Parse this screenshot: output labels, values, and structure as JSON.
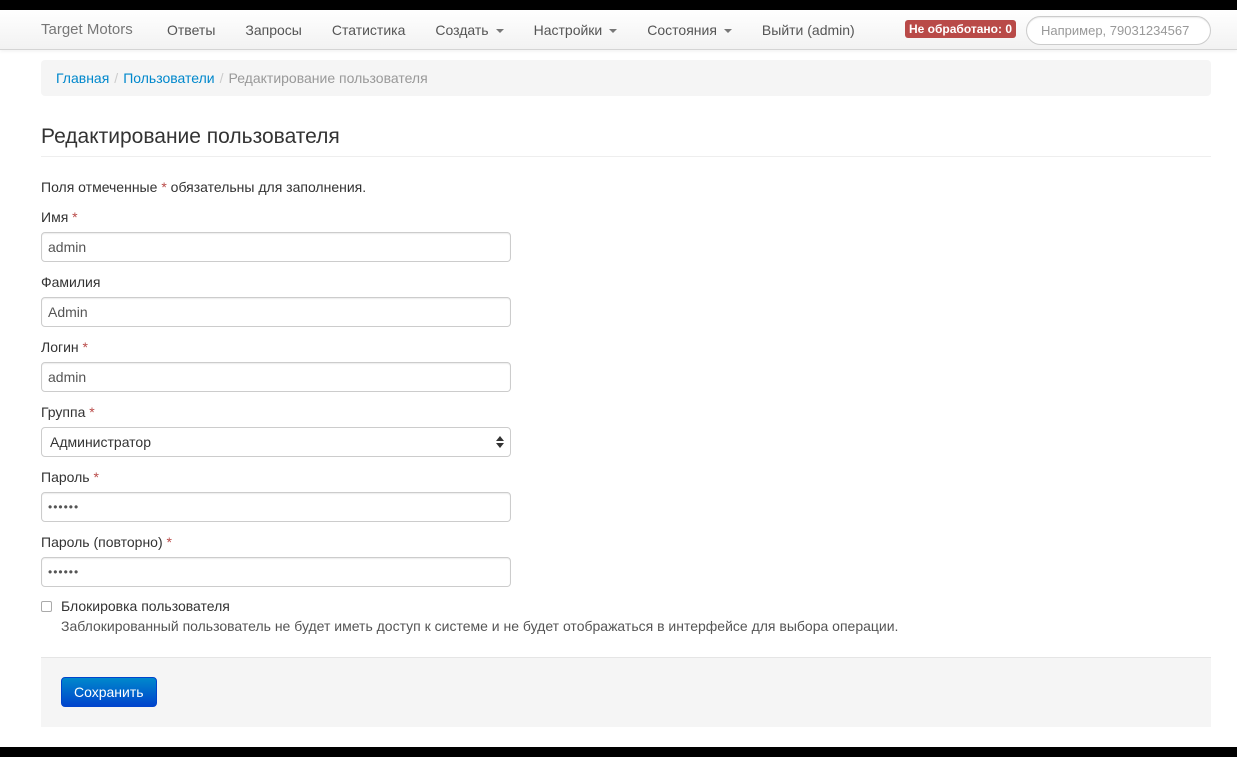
{
  "navbar": {
    "brand": "Target Motors",
    "items": [
      {
        "label": "Ответы",
        "dropdown": false
      },
      {
        "label": "Запросы",
        "dropdown": false
      },
      {
        "label": "Статистика",
        "dropdown": false
      },
      {
        "label": "Создать",
        "dropdown": true
      },
      {
        "label": "Настройки",
        "dropdown": true
      },
      {
        "label": "Состояния",
        "dropdown": true
      },
      {
        "label": "Выйти (admin)",
        "dropdown": false
      }
    ],
    "badge": "Не обработано: 0",
    "search_placeholder": "Например, 79031234567"
  },
  "breadcrumb": {
    "home": "Главная",
    "users": "Пользователи",
    "current": "Редактирование пользователя",
    "separator": "/"
  },
  "page": {
    "title": "Редактирование пользователя",
    "note_before": "Поля отмеченные ",
    "note_star": "*",
    "note_after": " обязательны для заполнения."
  },
  "form": {
    "required_mark": "*",
    "first_name": {
      "label": "Имя",
      "value": "admin"
    },
    "last_name": {
      "label": "Фамилия",
      "value": "Admin"
    },
    "login": {
      "label": "Логин",
      "value": "admin"
    },
    "group": {
      "label": "Группа",
      "value": "Администратор"
    },
    "password": {
      "label": "Пароль",
      "value": "••••••"
    },
    "password_repeat": {
      "label": "Пароль (повторно)",
      "value": "••••••"
    },
    "block": {
      "label": "Блокировка пользователя",
      "help": "Заблокированный пользователь не будет иметь доступ к системе и не будет отображаться в интерфейсе для выбора операции.",
      "checked": false
    },
    "save_label": "Сохранить"
  },
  "colors": {
    "link": "#0088cc",
    "required": "#b94a48",
    "primary": "#0044cc"
  }
}
